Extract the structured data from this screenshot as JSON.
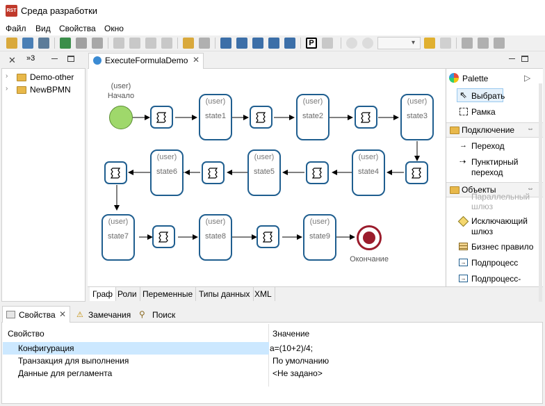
{
  "window": {
    "title": "Среда разработки",
    "icon_text": "RST"
  },
  "menu": [
    "Файл",
    "Вид",
    "Свойства",
    "Окно"
  ],
  "toolbar": {
    "zoom_value": ""
  },
  "left_panel": {
    "tab_count": "»3",
    "tree": [
      {
        "label": "Demo-other"
      },
      {
        "label": "NewBPMN"
      }
    ]
  },
  "editor": {
    "tab_label": "ExecuteFormulaDemo",
    "bottom_tabs": [
      "Граф",
      "Роли",
      "Переменные",
      "Типы данных",
      "XML"
    ],
    "nodes": {
      "start_role": "(user)",
      "start_label": "Начало",
      "end_label": "Окончание",
      "state_role": "(user)",
      "states": [
        "state1",
        "state2",
        "state3",
        "state4",
        "state5",
        "state6",
        "state7",
        "state8",
        "state9"
      ]
    }
  },
  "palette": {
    "title": "Palette",
    "tools": [
      "Выбрать",
      "Рамка"
    ],
    "sections": [
      {
        "title": "Подключение",
        "items": [
          "Переход",
          "Пунктирный переход"
        ]
      },
      {
        "title": "Объекты",
        "items": [
          "Параллельный шлюз",
          "Исключающий шлюз",
          "Бизнес правило",
          "Подпроцесс",
          "Подпроцесс-"
        ]
      }
    ]
  },
  "properties": {
    "tabs": [
      "Свойства",
      "Замечания",
      "Поиск"
    ],
    "columns": [
      "Свойство",
      "Значение"
    ],
    "rows": [
      {
        "name": "Конфигурация",
        "value": "a=(10+2)/4;"
      },
      {
        "name": "Транзакция для выполнения",
        "value": "По умолчанию"
      },
      {
        "name": "Данные для регламента",
        "value": "<Не задано>"
      }
    ]
  },
  "colors": {
    "accent": "#1f5e8f",
    "selection": "#cce8ff",
    "start": "#9fd86b",
    "end": "#9b1c2c"
  }
}
